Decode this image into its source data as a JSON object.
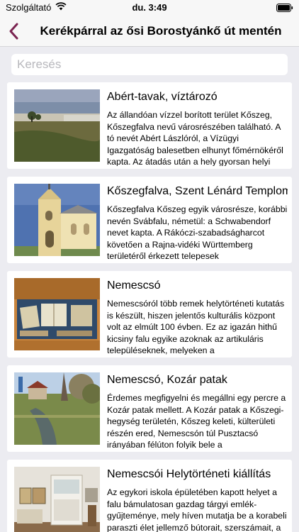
{
  "status": {
    "carrier": "Szolgáltató",
    "time": "du. 3:49"
  },
  "nav": {
    "title": "Kerékpárral az ősi Borostyánkő út mentén",
    "back_icon": "chevron-left-icon",
    "accent_color": "#7a2350"
  },
  "search": {
    "placeholder": "Keresés",
    "value": ""
  },
  "items": [
    {
      "title": "Abért-tavak, víztározó",
      "description": "Az állandóan vízzel borított terület Kőszeg, Kőszegfalva nevű városrészében található. A tó nevét Abért Lászlóról, a Vízügyi Igazgatóság balesetben elhunyt főmérnökéről kapta. Az átadás után a hely gyorsan helyi"
    },
    {
      "title": "Kőszegfalva, Szent Lénárd Templom",
      "description": "Kőszegfalva Kőszeg egyik városrésze, korábbi nevén Svábfalu, németül: a Schwabendorf nevet kapta. A Rákóczi-szabadságharcot követően a Rajna-vidéki Württemberg területéről érkezett telepesek"
    },
    {
      "title": "Nemescsó",
      "description": "Nemescsóról több remek helytörténeti kutatás is készült, hiszen jelentős kulturális központ volt az elmúlt 100 évben. Ez az igazán hithű kicsiny falu egyike azoknak az artikuláris településeknek, melyeken a"
    },
    {
      "title": "Nemescsó, Kozár patak",
      "description": "Érdemes megfigyelni és megállni egy percre a Kozár patak mellett. A Kozár patak a Kőszegi-hegység területén, Kőszeg keleti, külterületi részén ered, Nemescsón túl Pusztacsó irányában félúton folyik bele a"
    },
    {
      "title": "Nemescsói Helytörténeti kiállítás",
      "description": "Az egykori iskola épületében kapott helyet a falu bámulatosan gazdag tárgyi emlék-gyűjteménye, mely híven mutatja be a korabeli paraszti élet jellemző bútorait, szerszámait, a módos parasztok díszesebb"
    }
  ]
}
